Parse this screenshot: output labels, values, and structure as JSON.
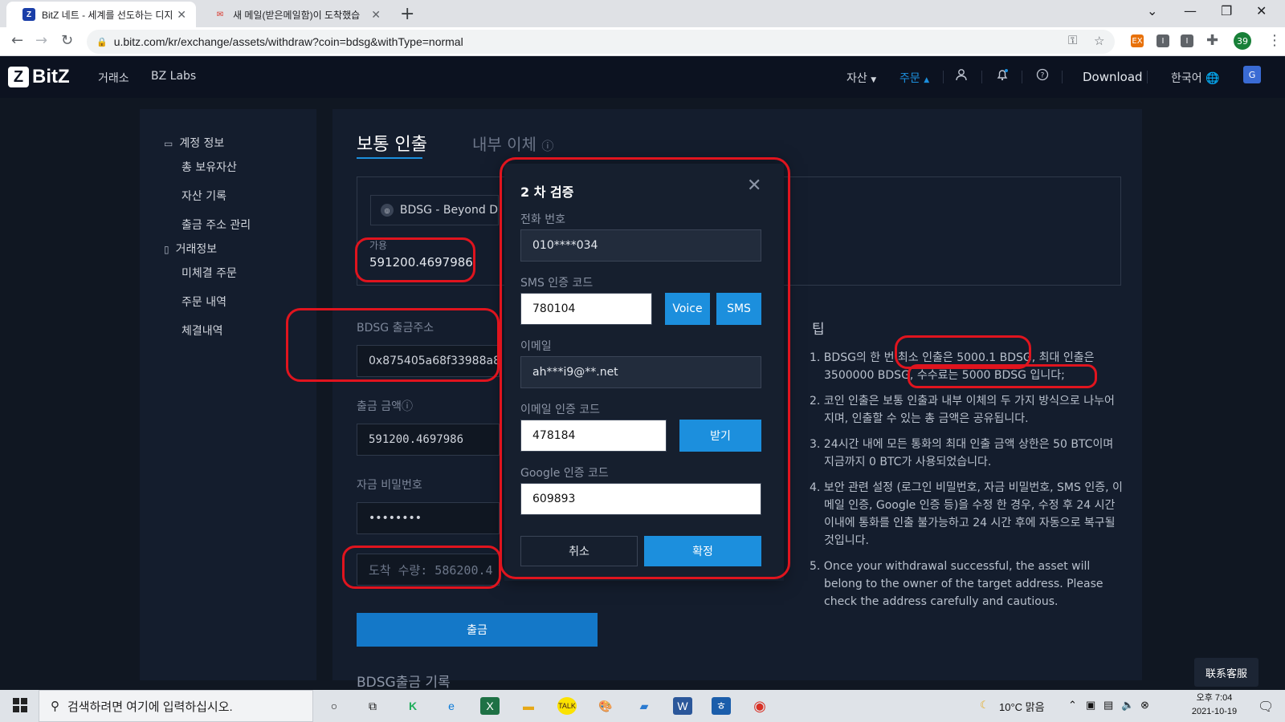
{
  "browser": {
    "tabs": [
      {
        "title": "BitZ 네트 - 세계를 선도하는 디지",
        "favicon": "Z"
      },
      {
        "title": "새 메일(받은메일함)이 도착했습",
        "favicon": "✉"
      }
    ],
    "url": "u.bitz.com/kr/exchange/assets/withdraw?coin=bdsg&withType=normal",
    "extensions": [
      "EX",
      "I",
      "I"
    ],
    "profile_count": "39"
  },
  "header": {
    "logo": "BitZ",
    "logo_mark": "Z",
    "nav": [
      "거래소",
      "BZ Labs"
    ],
    "right": {
      "assets": "자산",
      "orders": "주문",
      "download": "Download",
      "language": "한국어"
    }
  },
  "sidebar": {
    "account_section": "계정 정보",
    "account_items": [
      "총 보유자산",
      "자산 기록",
      "출금 주소 관리"
    ],
    "trade_section": "거래정보",
    "trade_items": [
      "미체결 주문",
      "주문 내역",
      "체결내역"
    ]
  },
  "withdraw": {
    "tab_normal": "보통 인출",
    "tab_internal": "내부 이체",
    "coin": "BDSG - Beyond D",
    "available_label": "가용",
    "available_value": "591200.4697986",
    "address_label": "BDSG 출금주소",
    "address_value": "0x875405a68f33988a8fc",
    "amount_label": "출금 금액",
    "amount_value": "591200.4697986",
    "password_label": "자금 비밀번호",
    "password_value": "••••••••",
    "arrival_value": "도착 수량: 586200.4",
    "submit": "출금",
    "history_title": "BDSG출금 기록"
  },
  "tips": {
    "title": "팁",
    "items": [
      "1. BDSG의 한 번 최소 인출은 5000.1 BDSG, 최대 인출은 3500000 BDSG, 수수료는 5000 BDSG 입니다;",
      "2. 코인 인출은 보통 인출과 내부 이체의 두 가지 방식으로 나누어지며, 인출할 수 있는 총 금액은 공유됩니다.",
      "3. 24시간 내에 모든 통화의 최대 인출 금액 상한은 50 BTC이며 지금까지 0 BTC가 사용되었습니다.",
      "4. 보안 관련 설정 (로그인 비밀번호, 자금 비밀번호, SMS 인증, 이메일 인증, Google 인증 등)을 수정 한 경우, 수정 후 24 시간 이내에 통화를 인출 불가능하고 24 시간 후에 자동으로 복구될 것입니다.",
      "5. Once your withdrawal successful, the asset will belong to the owner of the target address. Please check the address carefully and cautious."
    ]
  },
  "modal": {
    "title": "2 차 검증",
    "phone_label": "전화 번호",
    "phone_value": "010****034",
    "sms_label": "SMS 인증 코드",
    "sms_value": "780104",
    "voice_btn": "Voice",
    "sms_btn": "SMS",
    "email_label": "이메일",
    "email_value": "ah***i9@**.net",
    "email_code_label": "이메일 인증 코드",
    "email_code_value": "478184",
    "receive_btn": "받기",
    "google_label": "Google 인증 코드",
    "google_value": "609893",
    "cancel": "취소",
    "confirm": "확정"
  },
  "service_btn": "联系客服",
  "taskbar": {
    "search_placeholder": "검색하려면 여기에 입력하십시오.",
    "weather": "10°C  맑음",
    "time": "오후 7:04",
    "date": "2021-10-19"
  },
  "colors": {
    "accent": "#1c8fdd",
    "annotation": "#e0141e",
    "background": "#101722",
    "panel": "#141d2d"
  }
}
